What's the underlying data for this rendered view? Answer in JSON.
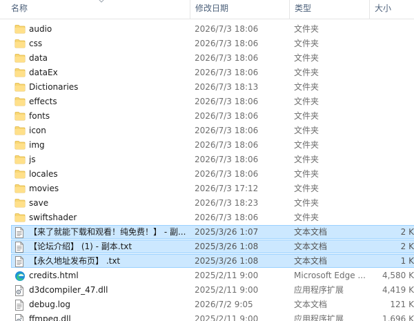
{
  "columns": {
    "name": "名称",
    "date": "修改日期",
    "type": "类型",
    "size": "大小"
  },
  "rows": [
    {
      "name": "audio",
      "date": "2026/7/3 18:06",
      "type": "文件夹",
      "size": "",
      "icon": "folder-icon",
      "selected": false
    },
    {
      "name": "css",
      "date": "2026/7/3 18:06",
      "type": "文件夹",
      "size": "",
      "icon": "folder-icon",
      "selected": false
    },
    {
      "name": "data",
      "date": "2026/7/3 18:06",
      "type": "文件夹",
      "size": "",
      "icon": "folder-icon",
      "selected": false
    },
    {
      "name": "dataEx",
      "date": "2026/7/3 18:06",
      "type": "文件夹",
      "size": "",
      "icon": "folder-icon",
      "selected": false
    },
    {
      "name": "Dictionaries",
      "date": "2026/7/3 18:13",
      "type": "文件夹",
      "size": "",
      "icon": "folder-icon",
      "selected": false
    },
    {
      "name": "effects",
      "date": "2026/7/3 18:06",
      "type": "文件夹",
      "size": "",
      "icon": "folder-icon",
      "selected": false
    },
    {
      "name": "fonts",
      "date": "2026/7/3 18:06",
      "type": "文件夹",
      "size": "",
      "icon": "folder-icon",
      "selected": false
    },
    {
      "name": "icon",
      "date": "2026/7/3 18:06",
      "type": "文件夹",
      "size": "",
      "icon": "folder-icon",
      "selected": false
    },
    {
      "name": "img",
      "date": "2026/7/3 18:06",
      "type": "文件夹",
      "size": "",
      "icon": "folder-icon",
      "selected": false
    },
    {
      "name": "js",
      "date": "2026/7/3 18:06",
      "type": "文件夹",
      "size": "",
      "icon": "folder-icon",
      "selected": false
    },
    {
      "name": "locales",
      "date": "2026/7/3 18:06",
      "type": "文件夹",
      "size": "",
      "icon": "folder-icon",
      "selected": false
    },
    {
      "name": "movies",
      "date": "2026/7/3 17:12",
      "type": "文件夹",
      "size": "",
      "icon": "folder-icon",
      "selected": false
    },
    {
      "name": "save",
      "date": "2026/7/3 18:23",
      "type": "文件夹",
      "size": "",
      "icon": "folder-icon",
      "selected": false
    },
    {
      "name": "swiftshader",
      "date": "2026/7/3 18:06",
      "type": "文件夹",
      "size": "",
      "icon": "folder-icon",
      "selected": false
    },
    {
      "name": "【来了就能下载和观看！纯免费！】 - 副...",
      "date": "2025/3/26 1:07",
      "type": "文本文档",
      "size": "2 K",
      "icon": "text-document-icon",
      "selected": true
    },
    {
      "name": "【论坛介绍】 (1) - 副本.txt",
      "date": "2025/3/26 1:08",
      "type": "文本文档",
      "size": "2 K",
      "icon": "text-document-icon",
      "selected": true
    },
    {
      "name": "【永久地址发布页】 .txt",
      "date": "2025/3/26 1:08",
      "type": "文本文档",
      "size": "1 K",
      "icon": "text-document-icon",
      "selected": true
    },
    {
      "name": "credits.html",
      "date": "2025/2/11 9:00",
      "type": "Microsoft Edge ...",
      "size": "4,580 K",
      "icon": "edge-icon",
      "selected": false
    },
    {
      "name": "d3dcompiler_47.dll",
      "date": "2025/2/11 9:00",
      "type": "应用程序扩展",
      "size": "4,419 K",
      "icon": "dll-file-icon",
      "selected": false
    },
    {
      "name": "debug.log",
      "date": "2026/7/2 9:05",
      "type": "文本文档",
      "size": "121 K",
      "icon": "text-document-icon",
      "selected": false
    },
    {
      "name": "ffmpeg.dll",
      "date": "2025/2/11 9:00",
      "type": "应用程序扩展",
      "size": "1,696 K",
      "icon": "dll-file-icon",
      "selected": false
    }
  ]
}
